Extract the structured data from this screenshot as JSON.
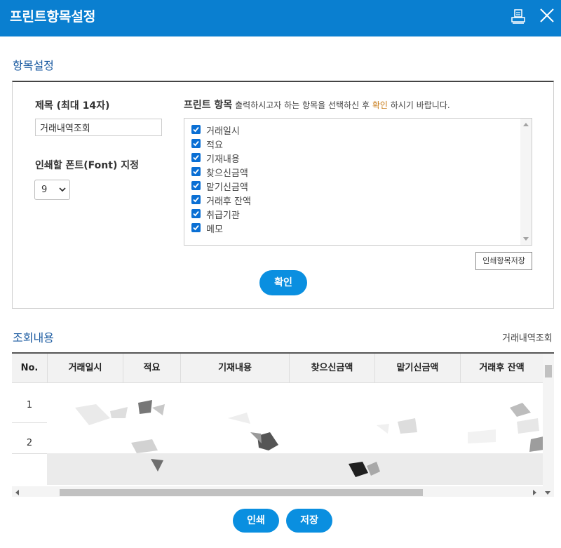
{
  "window": {
    "title": "프린트항목설정"
  },
  "settings": {
    "section_title": "항목설정",
    "title_label": "제목 (최대 14자)",
    "title_value": "거래내역조회",
    "font_label": "인쇄할 폰트(Font) 지정",
    "font_value": "9",
    "print_items_label": "프린트 항목",
    "hint_prefix": "출력하시고자 하는 항목을 선택하신 후",
    "hint_accent": "확인",
    "hint_suffix": "하시기 바랍니다.",
    "items": [
      {
        "label": "거래일시",
        "checked": true
      },
      {
        "label": "적요",
        "checked": true
      },
      {
        "label": "기재내용",
        "checked": true
      },
      {
        "label": "찾으신금액",
        "checked": true
      },
      {
        "label": "맡기신금액",
        "checked": true
      },
      {
        "label": "거래후 잔액",
        "checked": true
      },
      {
        "label": "취급기관",
        "checked": true
      },
      {
        "label": "메모",
        "checked": true
      }
    ],
    "save_items_label": "인쇄항목저장",
    "confirm_label": "확인"
  },
  "query": {
    "section_title": "조회내용",
    "title_right": "거래내역조회",
    "columns": [
      "No.",
      "거래일시",
      "적요",
      "기재내용",
      "찾으신금액",
      "맡기신금액",
      "거래후 잔액"
    ],
    "rows": [
      "1",
      "2"
    ]
  },
  "footer": {
    "print_label": "인쇄",
    "save_label": "저장"
  },
  "colors": {
    "accent": "#0a7fd0",
    "button": "#0a8fe0",
    "checkbox": "#0a6fd4",
    "hint_accent": "#c87b18"
  }
}
